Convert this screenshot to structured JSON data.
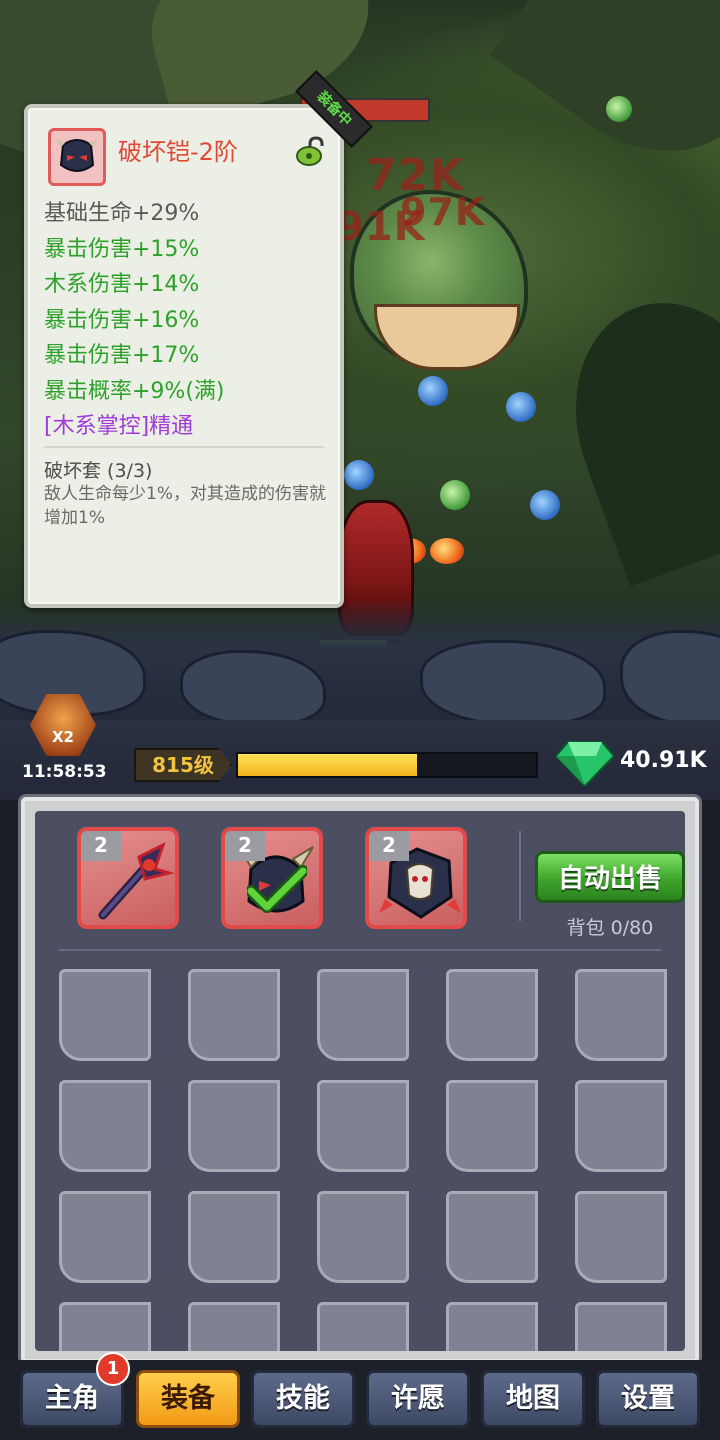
{
  "tooltip": {
    "item_name": "破坏铠-2阶",
    "equipped_tag": "装备中",
    "stats": [
      {
        "text": "基础生命+29%",
        "kind": "base"
      },
      {
        "text": "暴击伤害+15%",
        "kind": "green"
      },
      {
        "text": "木系伤害+14%",
        "kind": "green"
      },
      {
        "text": "暴击伤害+16%",
        "kind": "green"
      },
      {
        "text": "暴击伤害+17%",
        "kind": "green"
      },
      {
        "text": "暴击概率+9%(满)",
        "kind": "green"
      },
      {
        "text": "[木系掌控]精通",
        "kind": "purple"
      }
    ],
    "set_title": "破坏套  (3/3)",
    "set_desc": "敌人生命每少1%，对其造成的伤害就增加1%",
    "colors": {
      "name": "#e04a35",
      "green": "#2ea12a",
      "purple": "#a03ad8"
    }
  },
  "battle": {
    "damage_numbers": [
      "72K",
      "97K",
      "91K"
    ]
  },
  "status": {
    "boost_label": "X2",
    "timer": "11:58:53",
    "level": "815级",
    "xp_progress": 0.6,
    "gems": "40.91K"
  },
  "inventory": {
    "equipped": [
      {
        "level": "2",
        "icon": "staff-icon",
        "checked": false
      },
      {
        "level": "2",
        "icon": "helmet-icon",
        "checked": true
      },
      {
        "level": "2",
        "icon": "armor-icon",
        "checked": false
      }
    ],
    "auto_sell_label": "自动出售",
    "bag_label": "背包 0/80",
    "empty_slots": 20
  },
  "nav": {
    "tabs": [
      {
        "label": "主角",
        "active": false,
        "name": "tab-hero"
      },
      {
        "label": "装备",
        "active": true,
        "name": "tab-equipment"
      },
      {
        "label": "技能",
        "active": false,
        "name": "tab-skills"
      },
      {
        "label": "许愿",
        "active": false,
        "name": "tab-wish"
      },
      {
        "label": "地图",
        "active": false,
        "name": "tab-map"
      },
      {
        "label": "设置",
        "active": false,
        "name": "tab-settings"
      }
    ],
    "hero_badge": "1"
  }
}
